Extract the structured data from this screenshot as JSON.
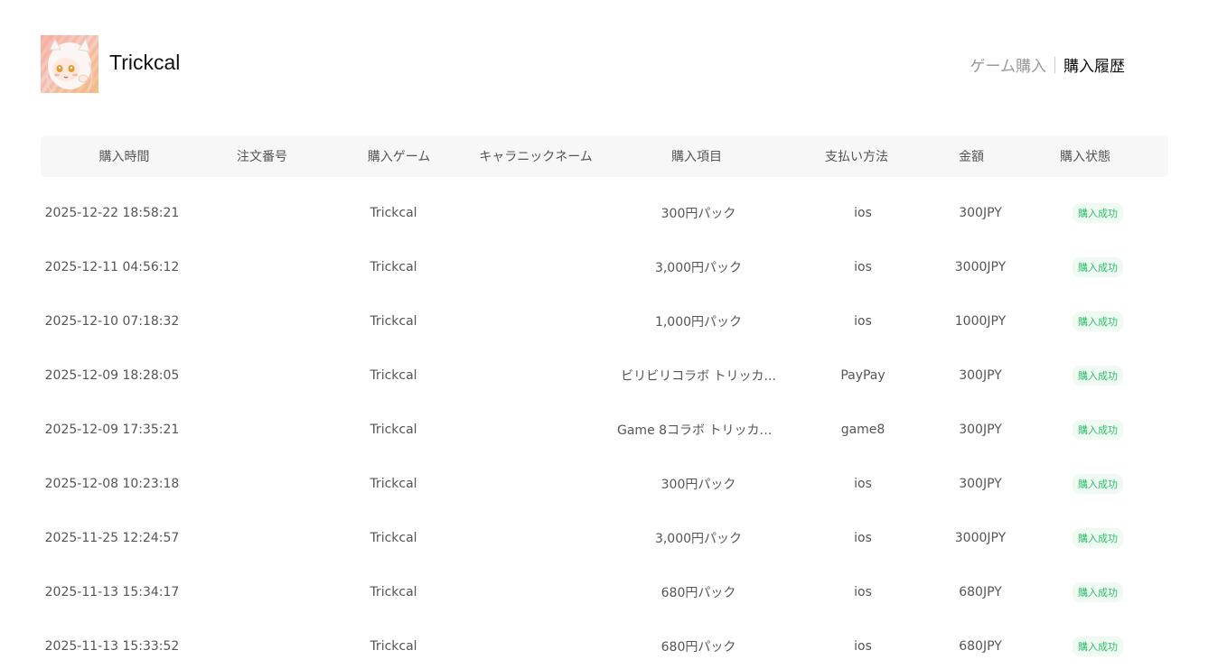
{
  "header": {
    "app_title": "Trickcal",
    "nav": {
      "buy_label": "ゲーム購入",
      "history_label": "購入履歴"
    }
  },
  "table": {
    "columns": [
      "購入時間",
      "注文番号",
      "購入ゲーム",
      "キャラニックネーム",
      "購入項目",
      "支払い方法",
      "金額",
      "購入状態"
    ],
    "rows": [
      {
        "time": "2025-12-22 18:58:21",
        "order": "",
        "game": "Trickcal",
        "nickname": "",
        "item": "300円パック",
        "payment": "ios",
        "amount": "300JPY",
        "status": "購入成功"
      },
      {
        "time": "2025-12-11 04:56:12",
        "order": "",
        "game": "Trickcal",
        "nickname": "",
        "item": "3,000円パック",
        "payment": "ios",
        "amount": "3000JPY",
        "status": "購入成功"
      },
      {
        "time": "2025-12-10 07:18:32",
        "order": "",
        "game": "Trickcal",
        "nickname": "",
        "item": "1,000円パック",
        "payment": "ios",
        "amount": "1000JPY",
        "status": "購入成功"
      },
      {
        "time": "2025-12-09 18:28:05",
        "order": "",
        "game": "Trickcal",
        "nickname": "",
        "item": "ビリビリコラボ トリッカ...",
        "payment": "PayPay",
        "amount": "300JPY",
        "status": "購入成功"
      },
      {
        "time": "2025-12-09 17:35:21",
        "order": "",
        "game": "Trickcal",
        "nickname": "",
        "item": "Game 8コラボ トリッカル...",
        "payment": "game8",
        "amount": "300JPY",
        "status": "購入成功"
      },
      {
        "time": "2025-12-08 10:23:18",
        "order": "",
        "game": "Trickcal",
        "nickname": "",
        "item": "300円パック",
        "payment": "ios",
        "amount": "300JPY",
        "status": "購入成功"
      },
      {
        "time": "2025-11-25 12:24:57",
        "order": "",
        "game": "Trickcal",
        "nickname": "",
        "item": "3,000円パック",
        "payment": "ios",
        "amount": "3000JPY",
        "status": "購入成功"
      },
      {
        "time": "2025-11-13 15:34:17",
        "order": "",
        "game": "Trickcal",
        "nickname": "",
        "item": "680円パック",
        "payment": "ios",
        "amount": "680JPY",
        "status": "購入成功"
      },
      {
        "time": "2025-11-13 15:33:52",
        "order": "",
        "game": "Trickcal",
        "nickname": "",
        "item": "680円パック",
        "payment": "ios",
        "amount": "680JPY",
        "status": "購入成功"
      }
    ]
  },
  "colors": {
    "status_success": "#2fbf6a",
    "status_bg": "#eefaf2",
    "header_bg": "#f7f7f7"
  },
  "icons": {
    "logo": "character-avatar-icon"
  }
}
